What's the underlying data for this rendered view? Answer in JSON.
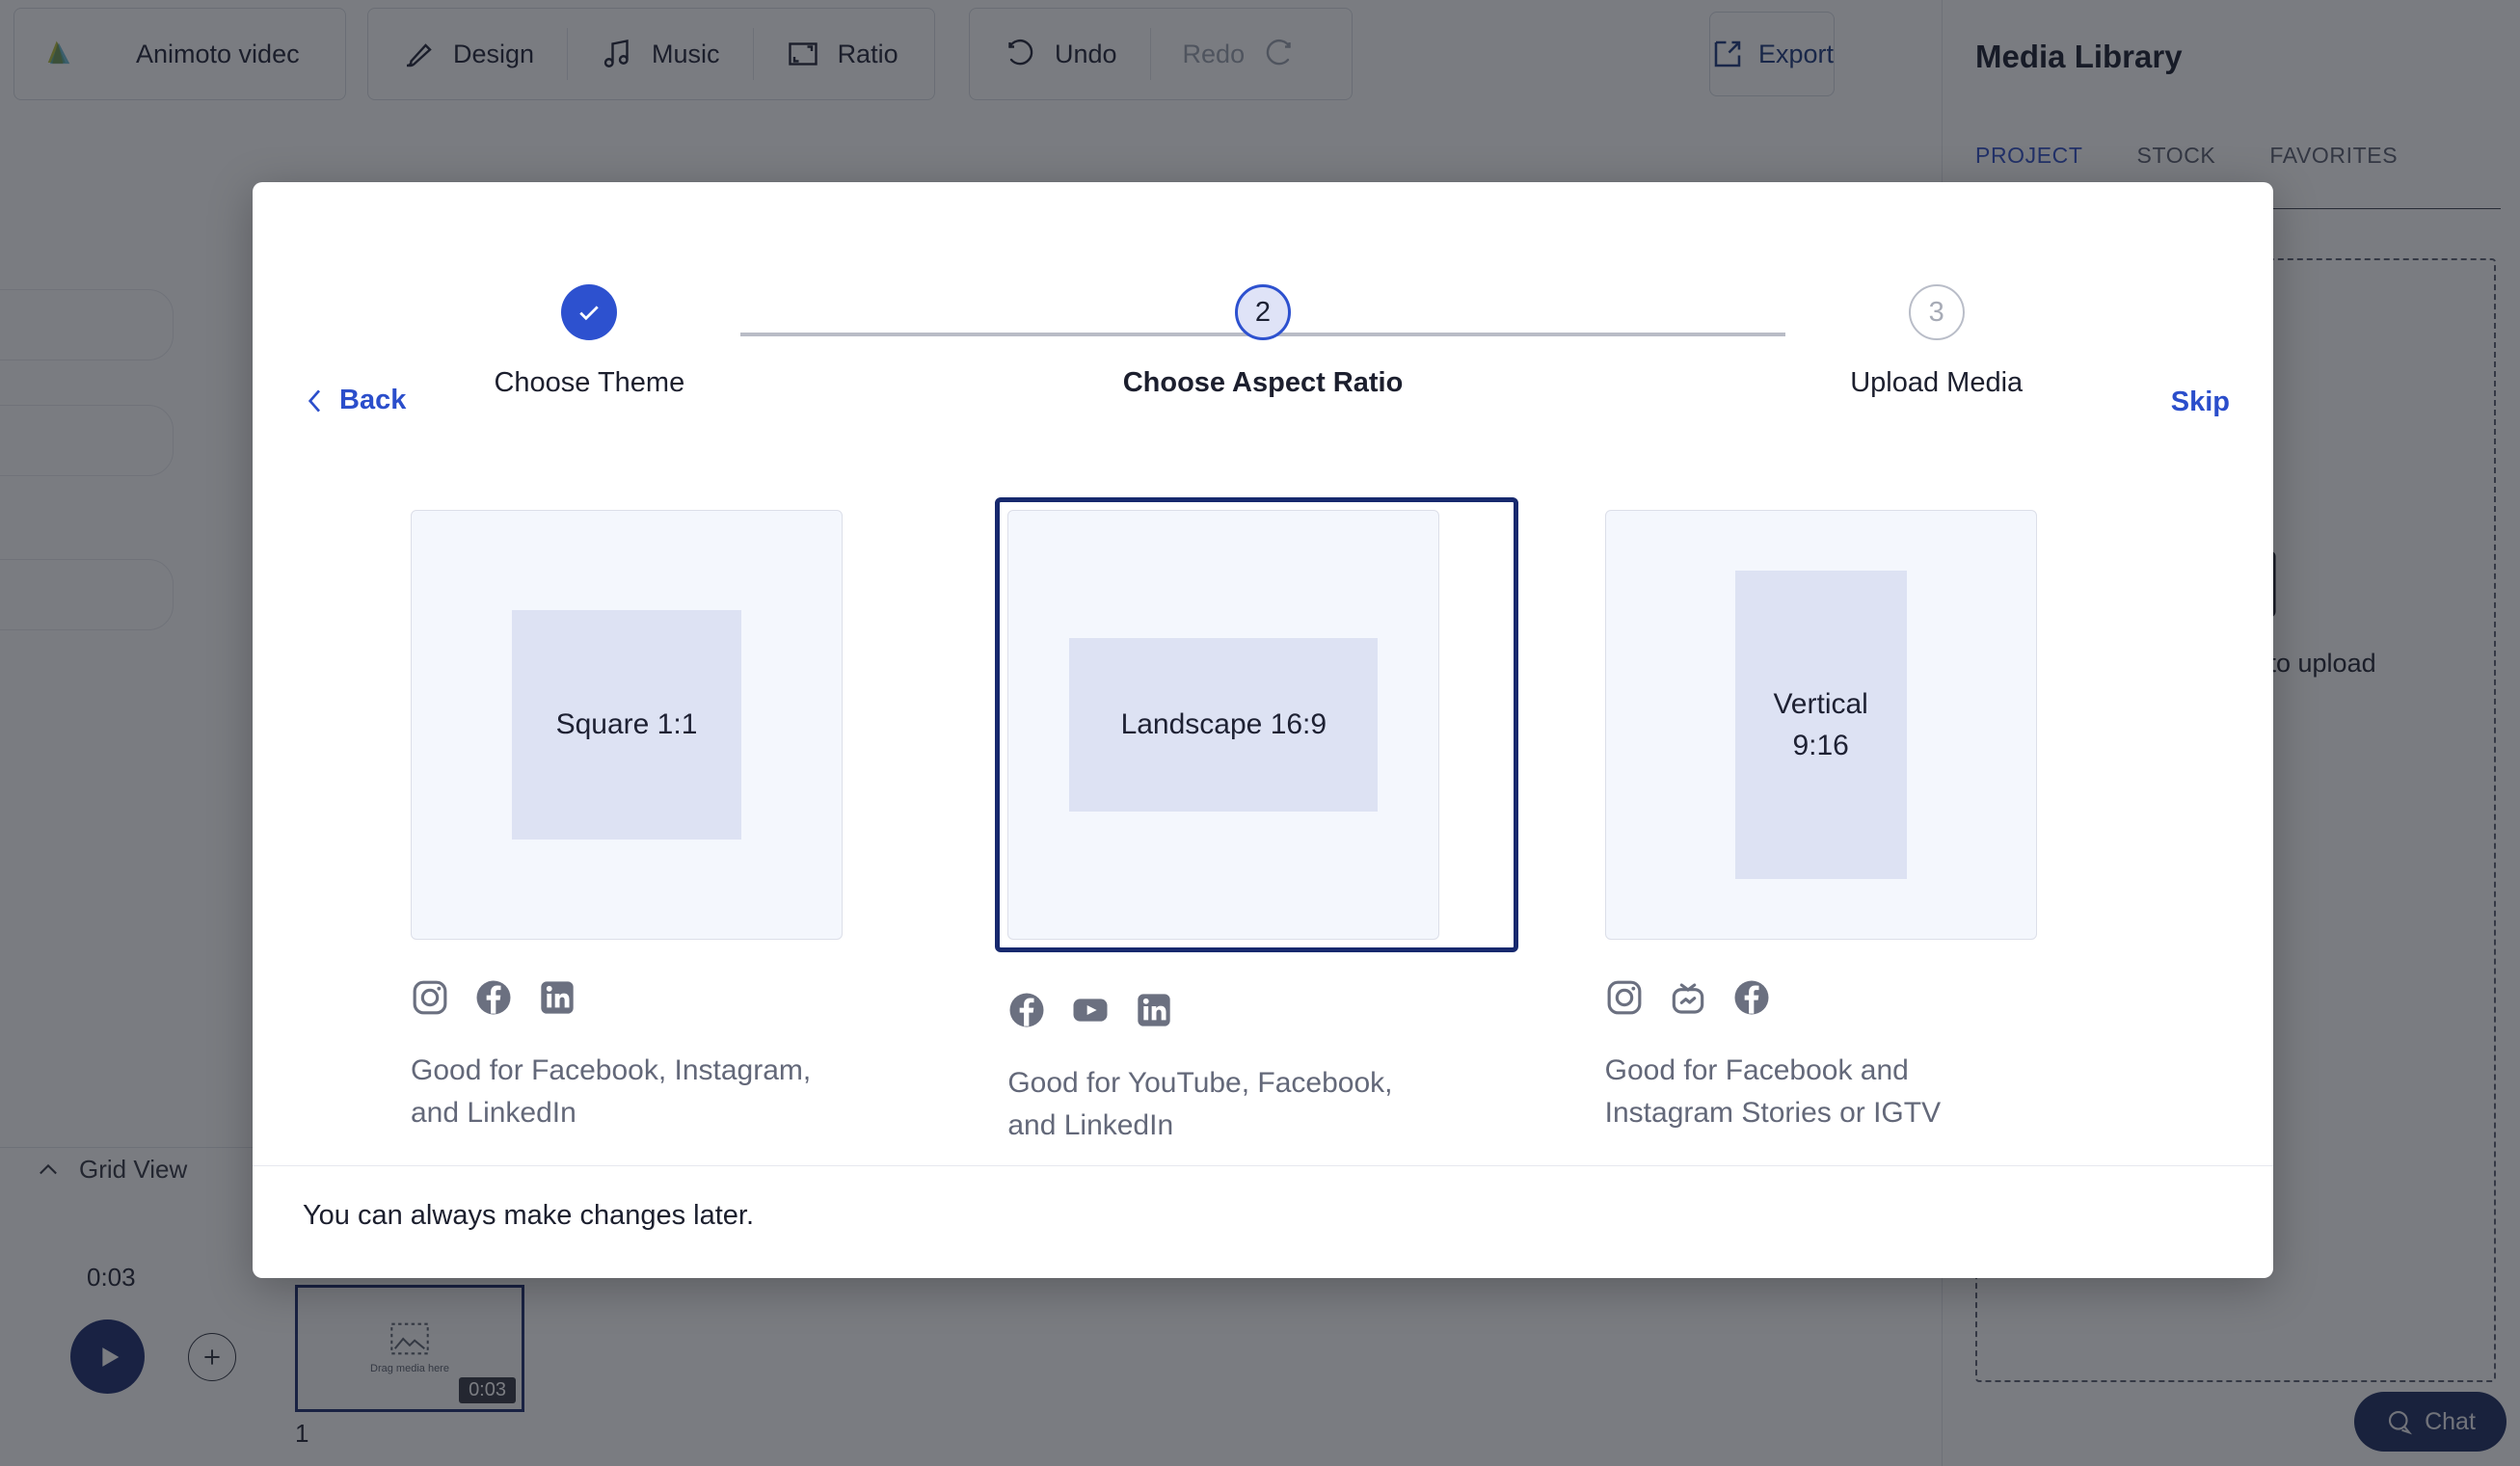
{
  "app": {
    "toolbar": {
      "project_name": "Animoto videc",
      "items": [
        {
          "label": "Design",
          "icon": "brush-icon"
        },
        {
          "label": "Music",
          "icon": "music-note-icon"
        },
        {
          "label": "Ratio",
          "icon": "aspect-ratio-icon"
        }
      ],
      "undo_label": "Undo",
      "redo_label": "Redo",
      "export_label": "Export"
    },
    "media_library": {
      "title": "Media Library",
      "tabs": [
        {
          "label": "PROJECT",
          "active": true
        },
        {
          "label": "STOCK",
          "active": false
        },
        {
          "label": "FAVORITES",
          "active": false
        }
      ],
      "dropzone_text": "Drag and drop to upload",
      "chat_label": "Chat"
    },
    "timeline": {
      "grid_view_label": "Grid View",
      "total_time": "0:03",
      "clip_caption": "Drag media here",
      "clip_duration": "0:03",
      "clip_index": "1"
    }
  },
  "modal": {
    "back_label": "Back",
    "skip_label": "Skip",
    "footer_note": "You can always make changes later.",
    "steps": [
      {
        "label": "Choose Theme",
        "marker": "✓",
        "state": "done"
      },
      {
        "label": "Choose Aspect Ratio",
        "marker": "2",
        "state": "current"
      },
      {
        "label": "Upload Media",
        "marker": "3",
        "state": "todo"
      }
    ],
    "options": [
      {
        "name": "square",
        "box_label": "Square 1:1",
        "selected": false,
        "socials": [
          "instagram-icon",
          "facebook-icon",
          "linkedin-icon"
        ],
        "note": "Good for Facebook, Instagram, and LinkedIn"
      },
      {
        "name": "landscape",
        "box_label": "Landscape 16:9",
        "selected": true,
        "socials": [
          "facebook-icon",
          "youtube-icon",
          "linkedin-icon"
        ],
        "note": "Good for YouTube, Facebook, and LinkedIn"
      },
      {
        "name": "vertical",
        "box_label": "Vertical\n9:16",
        "selected": false,
        "socials": [
          "instagram-icon",
          "igtv-icon",
          "facebook-icon"
        ],
        "note": "Good for Facebook and Instagram Stories or IGTV"
      }
    ]
  },
  "colors": {
    "accent_blue": "#2b4ecb",
    "navy": "#18296d",
    "selected_border": "#17296e",
    "card_bg": "#f4f7fd",
    "ratio_fill": "#dde2f3",
    "social_gray": "#6b7080"
  }
}
